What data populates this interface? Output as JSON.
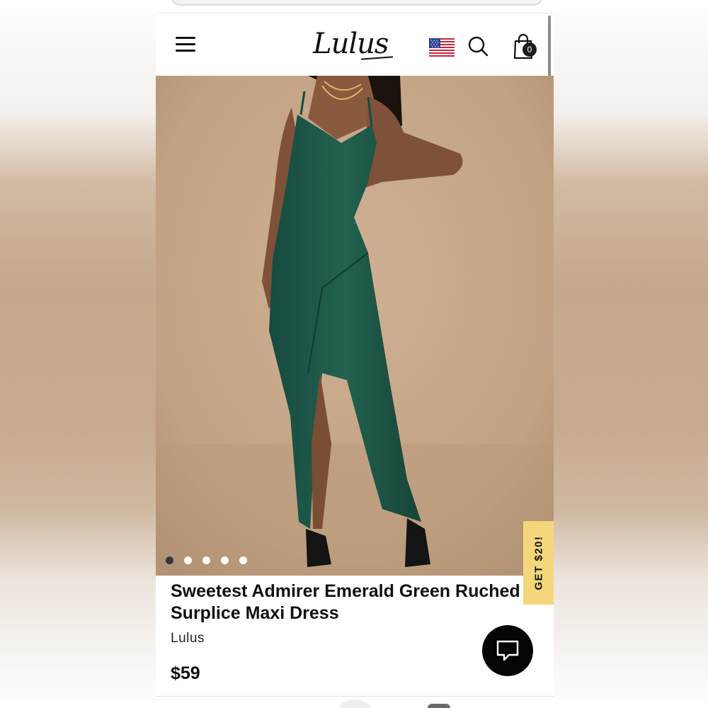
{
  "header": {
    "logo_text": "Lulus",
    "cart_count": "0"
  },
  "icons": {
    "menu": "hamburger-menu-icon",
    "flag": "us-flag-icon",
    "search": "search-icon",
    "cart": "shopping-bag-icon",
    "chat": "chat-bubble-icon"
  },
  "gallery": {
    "image_count": 5,
    "active_index": 0
  },
  "promo": {
    "label": "GET $20!",
    "color": "#f4d77a"
  },
  "product": {
    "title_line1": "Sweetest Admirer Emerald Green Ruched",
    "title_line2": "Surplice Maxi Dress",
    "brand": "Lulus",
    "price": "$59"
  },
  "colors": {
    "dress": "#1f5a4e",
    "backdrop": "#c4a587",
    "chat_button": "#050505"
  }
}
